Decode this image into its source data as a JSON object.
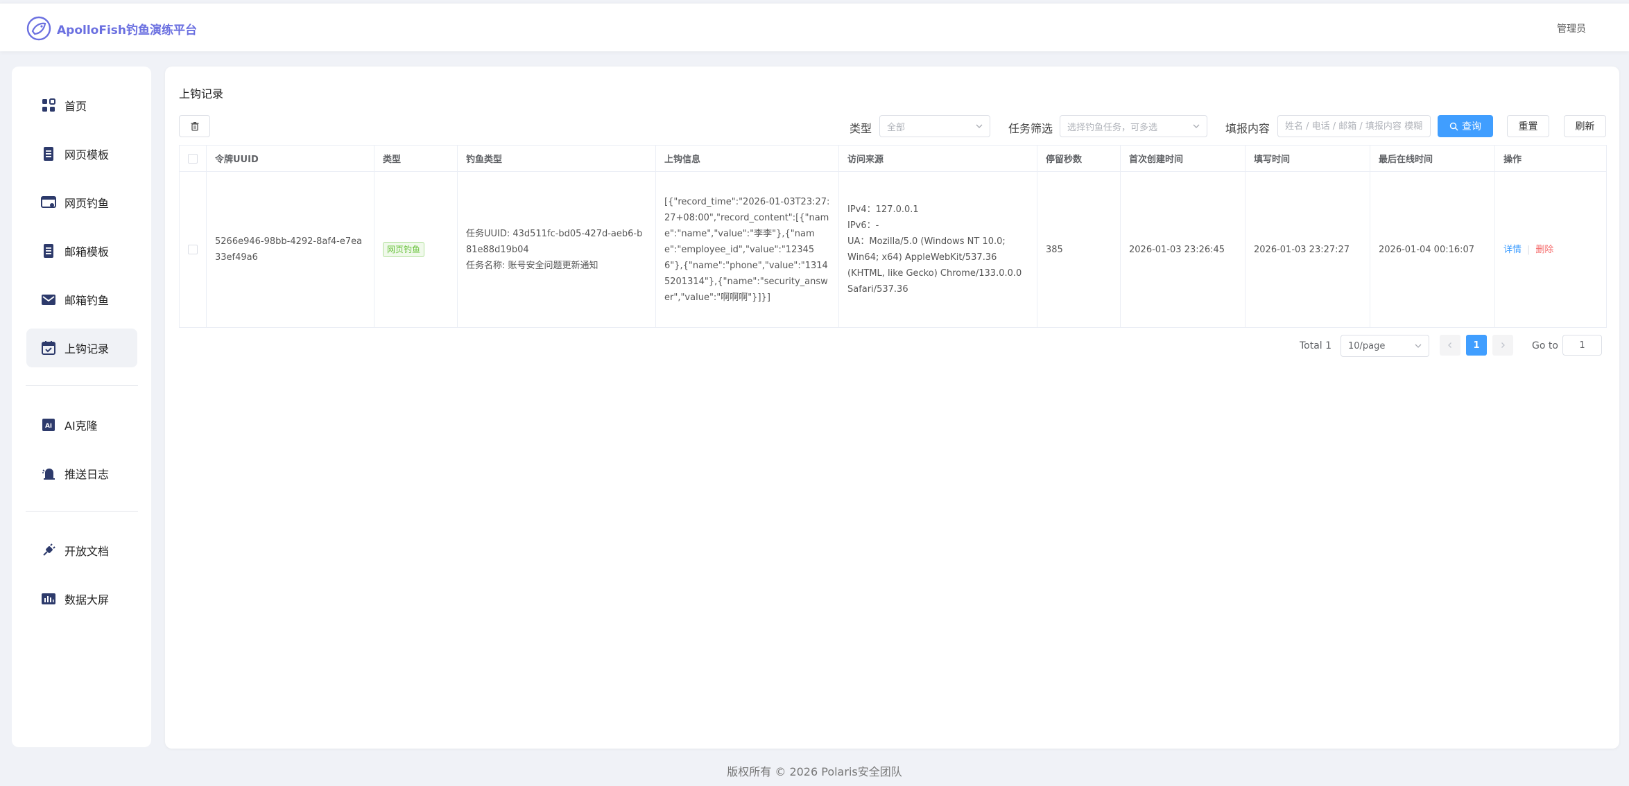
{
  "app": {
    "brand": "ApolloFish钓鱼演练平台",
    "user": "管理员"
  },
  "sidebar": {
    "items": [
      {
        "label": "首页",
        "icon": "grid-icon"
      },
      {
        "label": "网页模板",
        "icon": "document-icon"
      },
      {
        "label": "网页钓鱼",
        "icon": "browser-icon"
      },
      {
        "label": "邮箱模板",
        "icon": "document-icon"
      },
      {
        "label": "邮箱钓鱼",
        "icon": "mail-icon"
      },
      {
        "label": "上钩记录",
        "icon": "calendar-icon",
        "active": true
      },
      {
        "label": "AI克隆",
        "icon": "ai-icon"
      },
      {
        "label": "推送日志",
        "icon": "bell-icon"
      },
      {
        "label": "开放文档",
        "icon": "plug-icon"
      },
      {
        "label": "数据大屏",
        "icon": "chart-icon"
      }
    ]
  },
  "page": {
    "title": "上钩记录"
  },
  "filters": {
    "type_label": "类型",
    "type_value": "全部",
    "task_label": "任务筛选",
    "task_placeholder": "选择钓鱼任务，可多选",
    "content_label": "填报内容",
    "content_placeholder": "姓名 / 电话 / 邮箱 / 填报内容 模糊",
    "search_label": "查询",
    "reset_label": "重置",
    "refresh_label": "刷新"
  },
  "table": {
    "headers": [
      "令牌UUID",
      "类型",
      "钓鱼类型",
      "上钩信息",
      "访问来源",
      "停留秒数",
      "首次创建时间",
      "填写时间",
      "最后在线时间",
      "操作"
    ],
    "rows": [
      {
        "uuid": "5266e946-98bb-4292-8af4-e7ea33ef49a6",
        "type": "网页钓鱼",
        "phish_type_line1": "任务UUID: 43d511fc-bd05-427d-aeb6-b81e88d19b04",
        "phish_type_line2": "任务名称: 账号安全问题更新通知",
        "hook_info": "[{\"record_time\":\"2026-01-03T23:27:27+08:00\",\"record_content\":[{\"name\":\"name\",\"value\":\"李李\"},{\"name\":\"employee_id\",\"value\":\"123456\"},{\"name\":\"phone\",\"value\":\"13145201314\"},{\"name\":\"security_answer\",\"value\":\"啊啊啊\"}]}]",
        "ipv4": "IPv4：127.0.0.1",
        "ipv6": "IPv6：-",
        "ua": "UA：Mozilla/5.0 (Windows NT 10.0; Win64; x64) AppleWebKit/537.36 (KHTML, like Gecko) Chrome/133.0.0.0 Safari/537.36",
        "stay": "385",
        "created": "2026-01-03 23:26:45",
        "filled": "2026-01-03 23:27:27",
        "last_online": "2026-01-04 00:16:07",
        "action_detail": "详情",
        "action_delete": "删除"
      }
    ]
  },
  "pagination": {
    "total": "Total 1",
    "page_size": "10/page",
    "current": "1",
    "goto_label": "Go to",
    "goto_value": "1"
  },
  "footer": "版权所有 © 2026 Polaris安全团队",
  "colors": {
    "accent": "#409eff",
    "brand": "#6a6fe0",
    "danger": "#f56c6c",
    "success": "#67c23a"
  }
}
